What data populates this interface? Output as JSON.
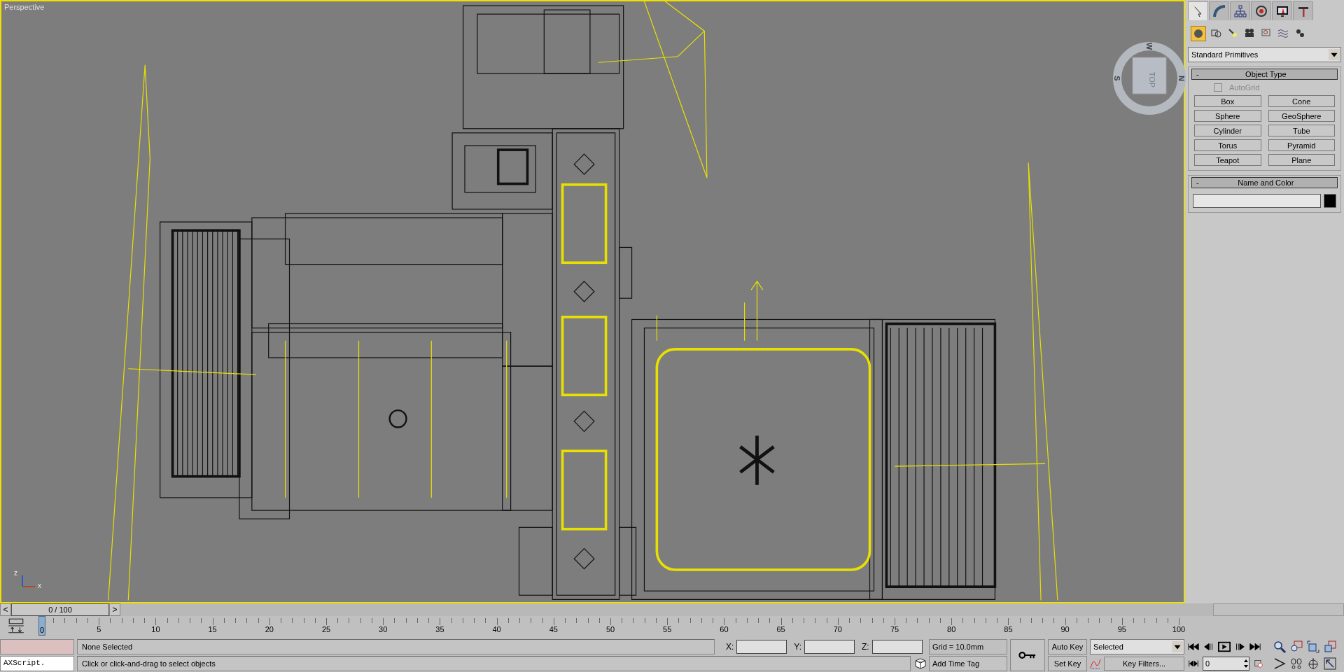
{
  "viewport": {
    "label": "Perspective",
    "viewcube": {
      "face": "TOP",
      "compass": [
        "W",
        "N",
        "S"
      ]
    },
    "axis_labels": [
      "z",
      "x"
    ]
  },
  "command_panel": {
    "tabs": [
      {
        "kind": "create",
        "selected": true
      },
      {
        "kind": "modify",
        "selected": false
      },
      {
        "kind": "hierarchy",
        "selected": false
      },
      {
        "kind": "motion",
        "selected": false
      },
      {
        "kind": "display",
        "selected": false
      },
      {
        "kind": "utilities",
        "selected": false
      }
    ],
    "categories": [
      {
        "kind": "geometry",
        "selected": true
      },
      {
        "kind": "shapes",
        "selected": false
      },
      {
        "kind": "lights",
        "selected": false
      },
      {
        "kind": "cameras",
        "selected": false
      },
      {
        "kind": "helpers",
        "selected": false
      },
      {
        "kind": "spacewarps",
        "selected": false
      },
      {
        "kind": "systems",
        "selected": false
      }
    ],
    "dropdown": "Standard Primitives",
    "object_type": {
      "collapse": "-",
      "title": "Object Type",
      "autogrid": {
        "label": "AutoGrid",
        "checked": false,
        "disabled": true
      },
      "buttons": [
        "Box",
        "Cone",
        "Sphere",
        "GeoSphere",
        "Cylinder",
        "Tube",
        "Torus",
        "Pyramid",
        "Teapot",
        "Plane"
      ]
    },
    "name_and_color": {
      "collapse": "-",
      "title": "Name and Color",
      "color": "#000000"
    }
  },
  "timeline": {
    "slider": "0 / 100",
    "prev": "<",
    "next": ">",
    "ticks": [
      {
        "label": "0",
        "selected": true
      },
      {
        "label": "5",
        "selected": false
      },
      {
        "label": "10",
        "selected": false
      },
      {
        "label": "15",
        "selected": false
      },
      {
        "label": "20",
        "selected": false
      },
      {
        "label": "25",
        "selected": false
      },
      {
        "label": "30",
        "selected": false
      },
      {
        "label": "35",
        "selected": false
      },
      {
        "label": "40",
        "selected": false
      },
      {
        "label": "45",
        "selected": false
      },
      {
        "label": "50",
        "selected": false
      },
      {
        "label": "55",
        "selected": false
      },
      {
        "label": "60",
        "selected": false
      },
      {
        "label": "65",
        "selected": false
      },
      {
        "label": "70",
        "selected": false
      },
      {
        "label": "75",
        "selected": false
      },
      {
        "label": "80",
        "selected": false
      },
      {
        "label": "85",
        "selected": false
      },
      {
        "label": "90",
        "selected": false
      },
      {
        "label": "95",
        "selected": false
      },
      {
        "label": "100",
        "selected": false
      }
    ]
  },
  "status_bar": {
    "listener": "AXScript.",
    "selection": "None Selected",
    "prompt": "Click or click-and-drag to select objects",
    "coords": [
      "X:",
      "Y:",
      "Z:"
    ],
    "grid": "Grid = 10.0mm",
    "time_tag": "Add Time Tag",
    "auto_key": "Auto Key",
    "set_key": "Set Key",
    "key_set": "Selected",
    "key_filters": "Key Filters...",
    "frame": "0"
  }
}
